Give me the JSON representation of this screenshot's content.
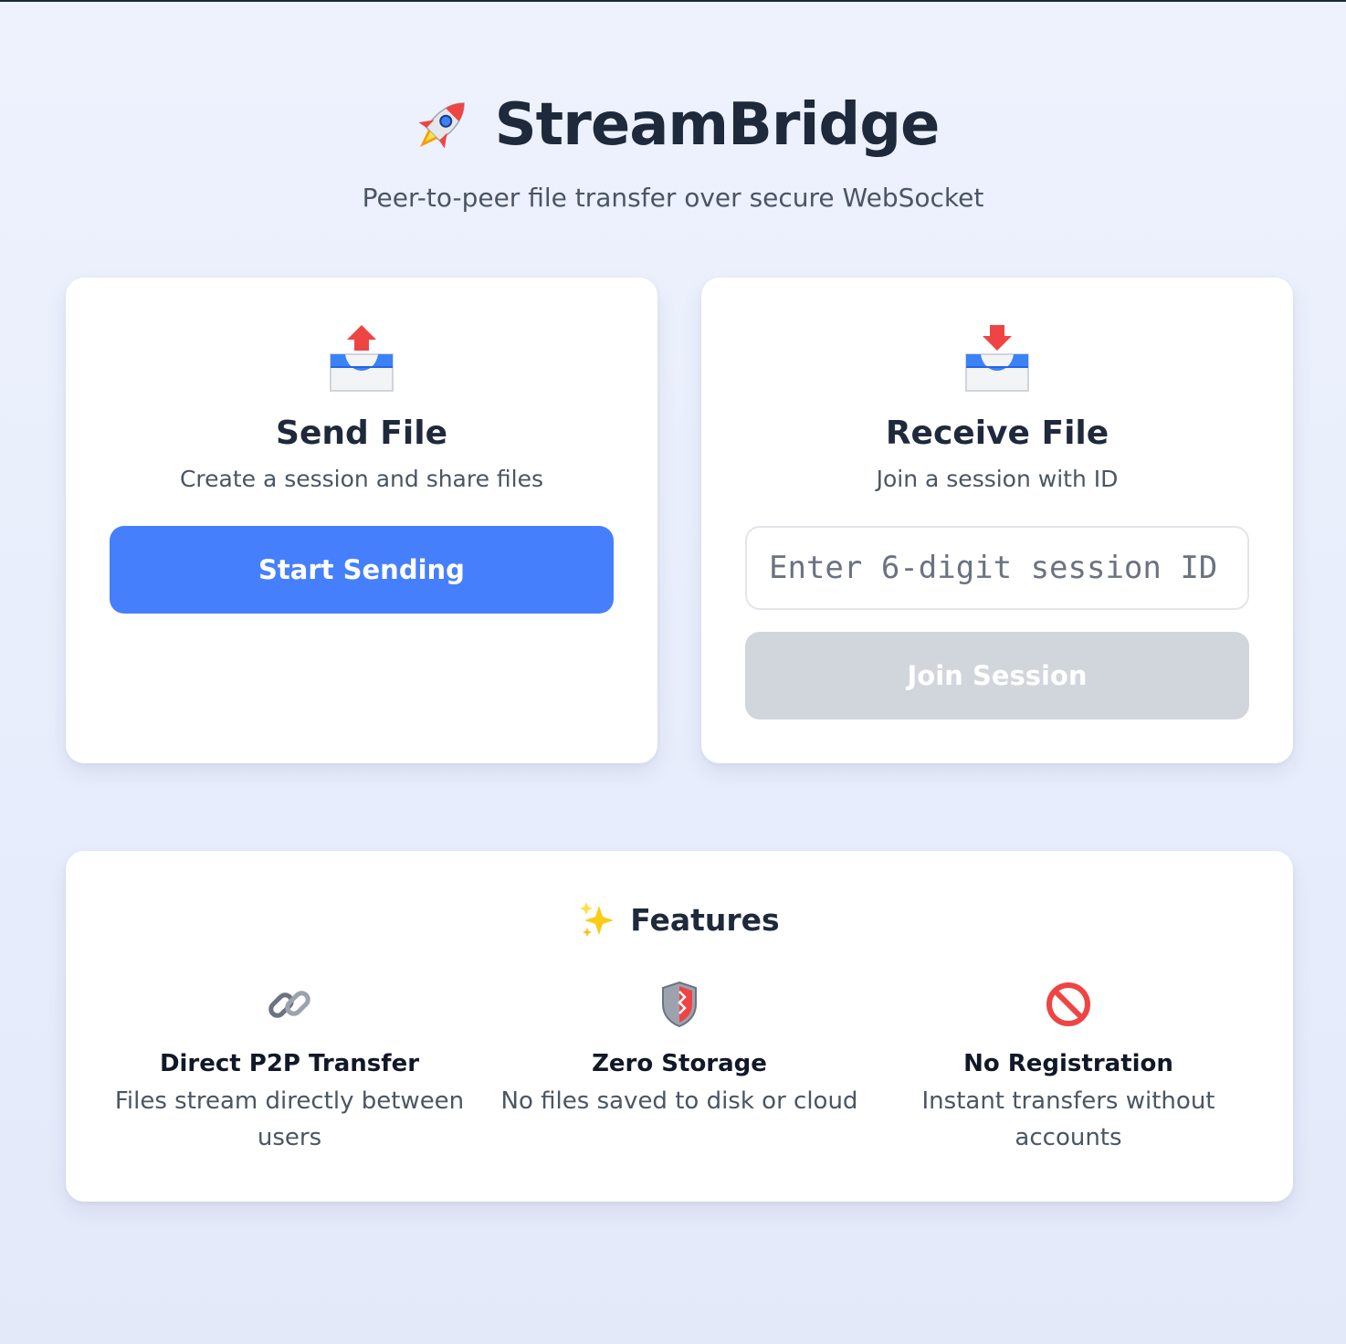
{
  "app": {
    "title": "StreamBridge",
    "subtitle": "Peer-to-peer file transfer over secure WebSocket",
    "logo_icon": "rocket-icon"
  },
  "send_card": {
    "icon": "outbox-tray-icon",
    "title": "Send File",
    "description": "Create a session and share files",
    "button_label": "Start Sending"
  },
  "receive_card": {
    "icon": "inbox-tray-icon",
    "title": "Receive File",
    "description": "Join a session with ID",
    "input_placeholder": "Enter 6-digit session ID",
    "input_value": "",
    "button_label": "Join Session",
    "button_disabled": true
  },
  "features": {
    "heading_icon": "sparkles-icon",
    "heading": "Features",
    "items": [
      {
        "icon": "link-icon",
        "title": "Direct P2P Transfer",
        "description": "Files stream directly between users"
      },
      {
        "icon": "shield-icon",
        "title": "Zero Storage",
        "description": "No files saved to disk or cloud"
      },
      {
        "icon": "prohibited-icon",
        "title": "No Registration",
        "description": "Instant transfers without accounts"
      }
    ]
  },
  "colors": {
    "primary_button": "#457ffb",
    "disabled_button": "#d1d5dc",
    "title_text": "#1e293b",
    "muted_text": "#4b5563",
    "background": "#eef2fd"
  }
}
